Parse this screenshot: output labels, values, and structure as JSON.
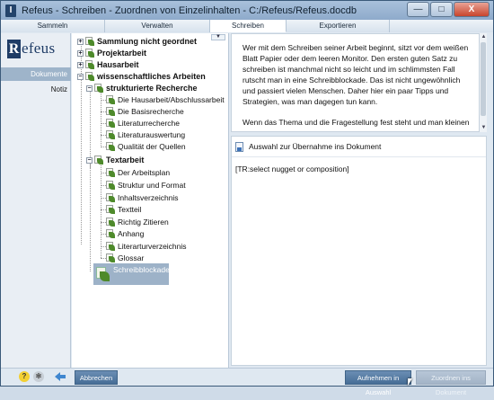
{
  "window": {
    "title": "Refeus - Schreiben - Zuordnen von Einzelinhalten - C:/Refeus/Refeus.docdb",
    "minimize": "—",
    "maximize": "□",
    "close": "X"
  },
  "tabs": [
    {
      "label": "Sammeln",
      "active": false
    },
    {
      "label": "Verwalten",
      "active": false
    },
    {
      "label": "Schreiben",
      "active": true
    },
    {
      "label": "Exportieren",
      "active": false
    }
  ],
  "sidebar": {
    "logo_mark": "R",
    "logo_text": "efeus",
    "items": [
      {
        "label": "Dokumente",
        "active": true
      },
      {
        "label": "Notiz",
        "active": false
      }
    ]
  },
  "tree": {
    "scroll_glyph": "▼",
    "nodes": [
      {
        "label": "Sammlung nicht geordnet",
        "bold": true
      },
      {
        "label": "Projektarbeit",
        "bold": true
      },
      {
        "label": "Hausarbeit",
        "bold": true
      },
      {
        "label": "wissenschaftliches Arbeiten",
        "bold": true
      },
      {
        "label": "strukturierte Recherche",
        "bold": true
      },
      {
        "label": "Die Hausarbeit/Abschlussarbeit",
        "bold": false
      },
      {
        "label": "Die Basisrecherche",
        "bold": false
      },
      {
        "label": "Literaturrecherche",
        "bold": false
      },
      {
        "label": "Literaturauswertung",
        "bold": false
      },
      {
        "label": "Qualität der Quellen",
        "bold": false
      },
      {
        "label": "Textarbeit",
        "bold": true
      },
      {
        "label": "Der Arbeitsplan",
        "bold": false
      },
      {
        "label": "Struktur und Format",
        "bold": false
      },
      {
        "label": "Inhaltsverzeichnis",
        "bold": false
      },
      {
        "label": "Textteil",
        "bold": false
      },
      {
        "label": "Richtig Zitieren",
        "bold": false
      },
      {
        "label": "Anhang",
        "bold": false
      },
      {
        "label": "Literarturverzeichnis",
        "bold": false
      },
      {
        "label": "Glossar",
        "bold": false
      }
    ],
    "selected": {
      "label": "Schreibblockade"
    }
  },
  "editor": {
    "paragraphs": [
      "Wer mit dem Schreiben seiner Arbeit beginnt, sitzt vor dem weißen Blatt Papier oder dem leeren Monitor. Den ersten guten Satz zu schreiben ist manchmal nicht so leicht und im schlimmsten Fall rutscht man in eine Schreibblockade. Das ist nicht ungewöhnlich und passiert vielen Menschen. Daher hier ein paar Tipps und Strategien, was man dagegen tun kann.",
      "Wenn das Thema und die Fragestellung fest steht und man kleinen"
    ]
  },
  "lower": {
    "hint": "Auswahl zur Übernahme ins Dokument",
    "placeholder": "[TR:select nugget or composition]"
  },
  "bottom": {
    "help": "?",
    "gear": "✻",
    "cancel": "Abbrechen",
    "apply": "Aufnehmen in Auswahl",
    "assign": "Zuordnen ins Dokument",
    "assign_enabled": false
  }
}
